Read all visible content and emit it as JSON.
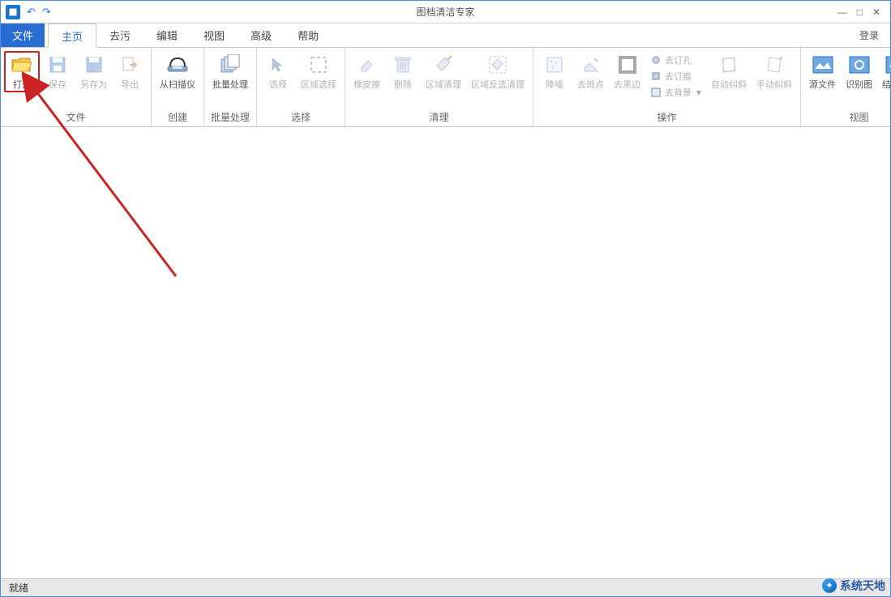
{
  "app": {
    "title": "图档清洁专家"
  },
  "titlebar": {
    "min": "—",
    "max": "□",
    "close": "✕"
  },
  "menu": {
    "file": "文件",
    "tabs": [
      "主页",
      "去污",
      "编辑",
      "视图",
      "高级",
      "帮助"
    ],
    "login": "登录"
  },
  "ribbon": {
    "groups": {
      "file": {
        "label": "文件",
        "open": "打开",
        "save": "保存",
        "saveas": "另存为",
        "export": "导出"
      },
      "create": {
        "label": "创建",
        "scanner": "从扫描仪"
      },
      "batch": {
        "label": "批量处理",
        "batch": "批量处理"
      },
      "select": {
        "label": "选择",
        "select": "选择",
        "area": "区域选择"
      },
      "clean": {
        "label": "清理",
        "eraser": "橡皮擦",
        "delete": "删除",
        "clean_area": "区域清理",
        "clean_inv": "区域反选清理"
      },
      "operate": {
        "label": "操作",
        "denoise": "降噪",
        "despeckle": "去斑点",
        "deblack": "去黑边",
        "dehole": "去订孔",
        "dehole2": "去订痕",
        "debg": "去背景",
        "autoskew": "自动纠斜",
        "manualskew": "手动纠斜"
      },
      "view": {
        "label": "视图",
        "src": "源文件",
        "recog": "识别图",
        "result": "结果图"
      }
    }
  },
  "status": {
    "ready": "就绪"
  },
  "watermark": {
    "text": "系统天地"
  }
}
